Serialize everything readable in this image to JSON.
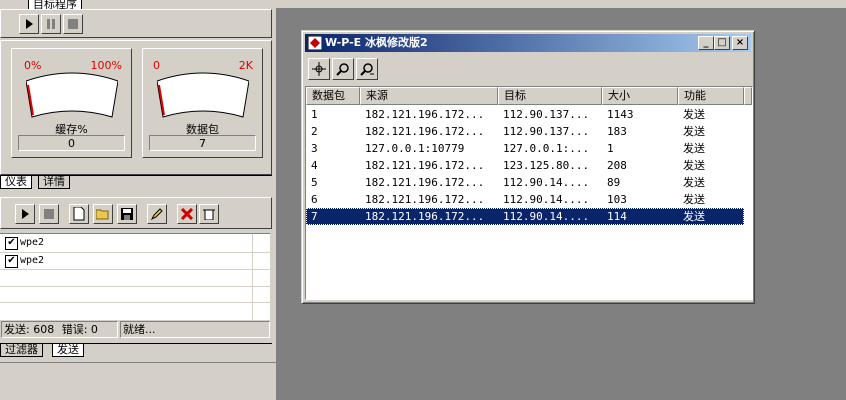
{
  "left_panel": {
    "title_tab": "目标程序",
    "gauges": [
      {
        "min": "0%",
        "max": "100%",
        "label": "缓存%",
        "value": "0"
      },
      {
        "min": "0",
        "max": "2K",
        "label": "数据包",
        "value": "7"
      }
    ],
    "tabs_top": [
      "仪表",
      "详情"
    ],
    "filter_items": [
      "wpe2",
      "wpe2"
    ],
    "status": {
      "sent": "发送: 608",
      "errors": "错误: 0",
      "state": "就绪..."
    },
    "tabs_bottom": [
      "过滤器",
      "发送"
    ]
  },
  "window": {
    "title": "W-P-E 冰枫修改版2",
    "columns": [
      "数据包",
      "来源",
      "目标",
      "大小",
      "功能"
    ],
    "rows": [
      {
        "id": "1",
        "src": "182.121.196.172...",
        "dst": "112.90.137...",
        "size": "1143",
        "func": "发送"
      },
      {
        "id": "2",
        "src": "182.121.196.172...",
        "dst": "112.90.137...",
        "size": "183",
        "func": "发送"
      },
      {
        "id": "3",
        "src": "127.0.0.1:10779",
        "dst": "127.0.0.1:...",
        "size": "1",
        "func": "发送"
      },
      {
        "id": "4",
        "src": "182.121.196.172...",
        "dst": "123.125.80...",
        "size": "208",
        "func": "发送"
      },
      {
        "id": "5",
        "src": "182.121.196.172...",
        "dst": "112.90.14....",
        "size": "89",
        "func": "发送"
      },
      {
        "id": "6",
        "src": "182.121.196.172...",
        "dst": "112.90.14....",
        "size": "103",
        "func": "发送"
      },
      {
        "id": "7",
        "src": "182.121.196.172...",
        "dst": "112.90.14....",
        "size": "114",
        "func": "发送"
      }
    ],
    "selected_row": 7
  }
}
